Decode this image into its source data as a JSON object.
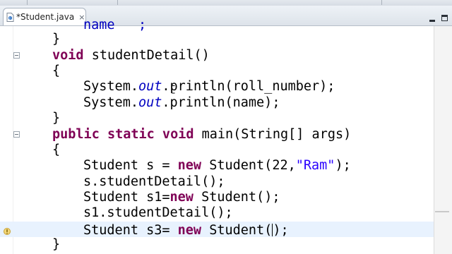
{
  "tab": {
    "label": "*Student.java",
    "close": "×"
  },
  "icons": {
    "file": "java-file-icon",
    "close": "close-icon",
    "minimize": "minimize-icon",
    "maximize": "maximize-icon",
    "fold": "fold-collapse-icon"
  },
  "colors": {
    "keyword": "#7f0055",
    "string": "#2a00ff",
    "field": "#0000c0",
    "current_line": "#e8f2fe"
  },
  "code": [
    {
      "text": "name   ;",
      "indent": 2
    },
    {
      "text": "}",
      "indent": 1
    },
    {
      "text": "void studentDetail()",
      "indent": 1,
      "fold": true
    },
    {
      "text": "{",
      "indent": 1
    },
    {
      "text": "System.out.println(roll_number);",
      "indent": 2
    },
    {
      "text": "System.out.println(name);",
      "indent": 2
    },
    {
      "text": "}",
      "indent": 1
    },
    {
      "text": "public static void main(String[] args)",
      "indent": 1,
      "fold": true
    },
    {
      "text": "{",
      "indent": 1
    },
    {
      "text": "Student s = new Student(22,\"Ram\");",
      "indent": 2
    },
    {
      "text": "s.studentDetail();",
      "indent": 2
    },
    {
      "text": "Student s1=new Student();",
      "indent": 2
    },
    {
      "text": "s1.studentDetail();",
      "indent": 2
    },
    {
      "text": "Student s3= new Student();",
      "indent": 2,
      "current": true
    },
    {
      "text": "}",
      "indent": 1
    }
  ],
  "tokens": {
    "l0_a": "name   ;",
    "l1": "}",
    "l2_kw": "void",
    "l2_rest": " studentDetail()",
    "l3": "{",
    "l4_a": "System.",
    "l4_out": "out",
    "l4_b": ".println(roll_number);",
    "l5_a": "System.",
    "l5_out": "out",
    "l5_b": ".println(name);",
    "l6": "}",
    "l7_kw": "public static void",
    "l7_rest": " main(String[] args)",
    "l8": "{",
    "l9_a": "Student s = ",
    "l9_kw": "new",
    "l9_b": " Student(22,",
    "l9_str": "\"Ram\"",
    "l9_c": ");",
    "l10": "s.studentDetail();",
    "l11_a": "Student s1=",
    "l11_kw": "new",
    "l11_b": " Student();",
    "l12": "s1.studentDetail();",
    "l13_a": "Student s3= ",
    "l13_kw": "new",
    "l13_b": " Student(",
    "l13_c": ");",
    "l14": "}"
  }
}
